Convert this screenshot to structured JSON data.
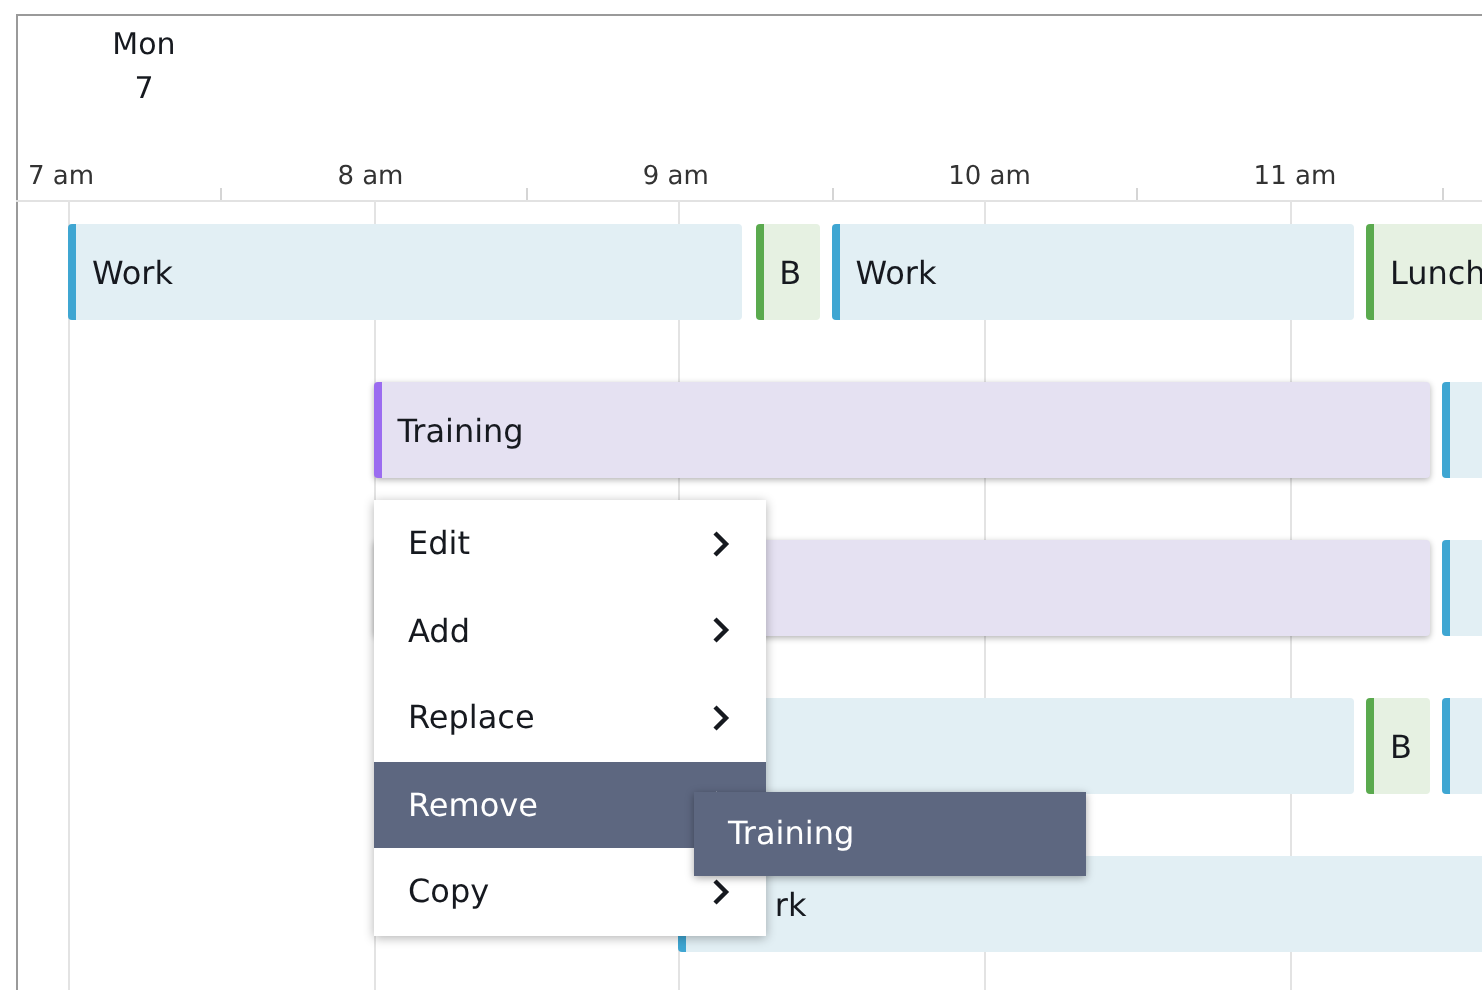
{
  "day": {
    "name": "Mon",
    "date": "7"
  },
  "ticks": [
    "7 am",
    "8 am",
    "9 am",
    "10 am",
    "11 am"
  ],
  "rows": [
    {
      "blocks": [
        {
          "kind": "work",
          "label": "Work"
        },
        {
          "kind": "break",
          "label": "B"
        },
        {
          "kind": "work",
          "label": "Work"
        },
        {
          "kind": "break",
          "label": "Lunch"
        }
      ]
    },
    {
      "blocks": [
        {
          "kind": "training",
          "label": "Training"
        },
        {
          "kind": "work"
        }
      ]
    },
    {
      "blocks": [
        {
          "kind": "training"
        },
        {
          "kind": "work"
        }
      ]
    },
    {
      "blocks": [
        {
          "kind": "work"
        },
        {
          "kind": "break",
          "label": "B"
        },
        {
          "kind": "work"
        }
      ]
    },
    {
      "blocks": [
        {
          "kind": "work",
          "label": "rk"
        }
      ]
    }
  ],
  "menu": {
    "items": [
      {
        "label": "Edit",
        "selected": false
      },
      {
        "label": "Add",
        "selected": false
      },
      {
        "label": "Replace",
        "selected": false
      },
      {
        "label": "Remove",
        "selected": true
      },
      {
        "label": "Copy",
        "selected": false
      }
    ],
    "submenu": {
      "items": [
        {
          "label": "Training"
        }
      ]
    }
  }
}
